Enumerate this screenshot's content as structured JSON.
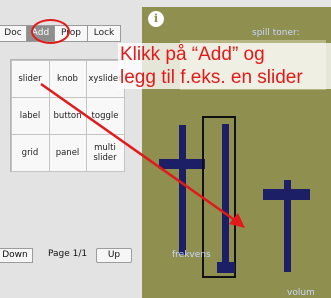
{
  "tabs": [
    {
      "label": "Doc",
      "selected": false
    },
    {
      "label": "Add",
      "selected": true
    },
    {
      "label": "Prop",
      "selected": false
    },
    {
      "label": "Lock",
      "selected": false
    }
  ],
  "palette": {
    "items": [
      "slider",
      "knob",
      "xyslider",
      "label",
      "button",
      "toggle",
      "grid",
      "panel",
      "multi slider"
    ]
  },
  "pager": {
    "down": "Down",
    "page": "Page 1/1",
    "up": "Up"
  },
  "canvas": {
    "info_icon": "info-icon",
    "toner_label": "spill toner:",
    "frekvens_label": "frekvens",
    "volum_label": "volum",
    "background_color": "#8f8f4f",
    "widget_color": "#1c1e66"
  },
  "annotation": {
    "line1": "Klikk på “Add” og",
    "line2": "legg til f.eks. en slider",
    "color": "#e21a1a"
  }
}
